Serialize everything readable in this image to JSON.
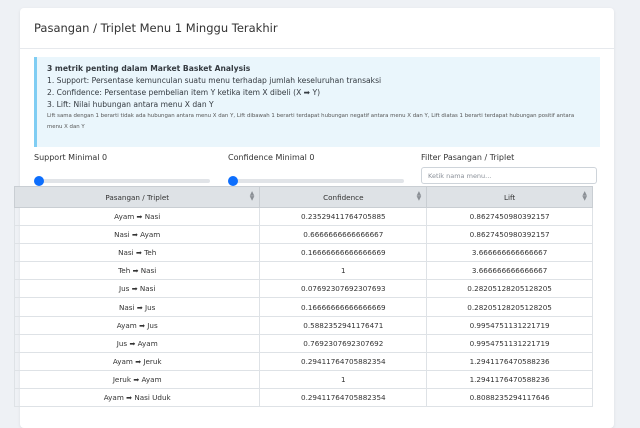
{
  "header": {
    "title": "Pasangan / Triplet Menu 1 Minggu Terakhir"
  },
  "info": {
    "title": "3 metrik penting dalam Market Basket Analysis",
    "line1": "1. Support: Persentase kemunculan suatu menu terhadap jumlah keseluruhan transaksi",
    "line2": "2. Confidence: Persentase pembelian item Y ketika item X dibeli (X ➡ Y)",
    "line3": "3. Lift: Nilai hubungan antara menu X dan Y",
    "note": "Lift sama dengan 1 berarti tidak ada hubungan antara menu X dan Y, Lift dibawah 1 berarti terdapat hubungan negatif antara menu X dan Y, Lift diatas 1 berarti terdapat hubungan positif antara menu X dan Y"
  },
  "filters": {
    "support_label": "Support Minimal 0",
    "support_value": 0,
    "confidence_label": "Confidence Minimal 0",
    "confidence_value": 0,
    "pair_label": "Filter Pasangan / Triplet",
    "pair_placeholder": "Ketik nama menu..."
  },
  "table": {
    "columns": [
      "Pasangan / Triplet",
      "Confidence",
      "Lift"
    ],
    "rows": [
      {
        "x": "Ayam",
        "y": "Nasi",
        "confidence": "0.23529411764705885",
        "lift": "0.8627450980392157"
      },
      {
        "x": "Nasi",
        "y": "Ayam",
        "confidence": "0.6666666666666667",
        "lift": "0.8627450980392157"
      },
      {
        "x": "Nasi",
        "y": "Teh",
        "confidence": "0.16666666666666669",
        "lift": "3.666666666666667"
      },
      {
        "x": "Teh",
        "y": "Nasi",
        "confidence": "1",
        "lift": "3.666666666666667"
      },
      {
        "x": "Jus",
        "y": "Nasi",
        "confidence": "0.07692307692307693",
        "lift": "0.28205128205128205"
      },
      {
        "x": "Nasi",
        "y": "Jus",
        "confidence": "0.16666666666666669",
        "lift": "0.28205128205128205"
      },
      {
        "x": "Ayam",
        "y": "Jus",
        "confidence": "0.5882352941176471",
        "lift": "0.9954751131221719"
      },
      {
        "x": "Jus",
        "y": "Ayam",
        "confidence": "0.7692307692307692",
        "lift": "0.9954751131221719"
      },
      {
        "x": "Ayam",
        "y": "Jeruk",
        "confidence": "0.29411764705882354",
        "lift": "1.2941176470588236"
      },
      {
        "x": "Jeruk",
        "y": "Ayam",
        "confidence": "1",
        "lift": "1.2941176470588236"
      },
      {
        "x": "Ayam",
        "y": "Nasi Uduk",
        "confidence": "0.29411764705882354",
        "lift": "0.8088235294117646"
      }
    ]
  },
  "icons": {
    "arrow": "arrow-right-icon",
    "sort": "sort-icon"
  },
  "colors": {
    "accent": "#0d6efd",
    "info_bg": "#eaf6fc",
    "info_border": "#7fcdf3",
    "header_bg": "#dee2e6"
  }
}
